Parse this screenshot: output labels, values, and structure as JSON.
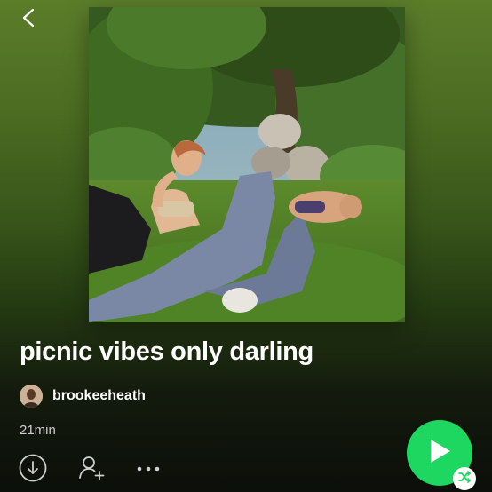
{
  "header": {
    "back_icon": "chevron-left-icon"
  },
  "playlist": {
    "title": "picnic vibes only darling",
    "owner": "brookeeheath",
    "duration": "21min"
  },
  "actions": {
    "download_icon": "download-icon",
    "follow_icon": "add-user-icon",
    "more_icon": "more-icon",
    "play_icon": "play-icon",
    "shuffle_icon": "shuffle-icon"
  },
  "colors": {
    "accent": "#1ed760",
    "background_top": "#5b7d2a",
    "background_bottom": "#0c0f0a",
    "secondary_text": "#cfcfcf"
  }
}
